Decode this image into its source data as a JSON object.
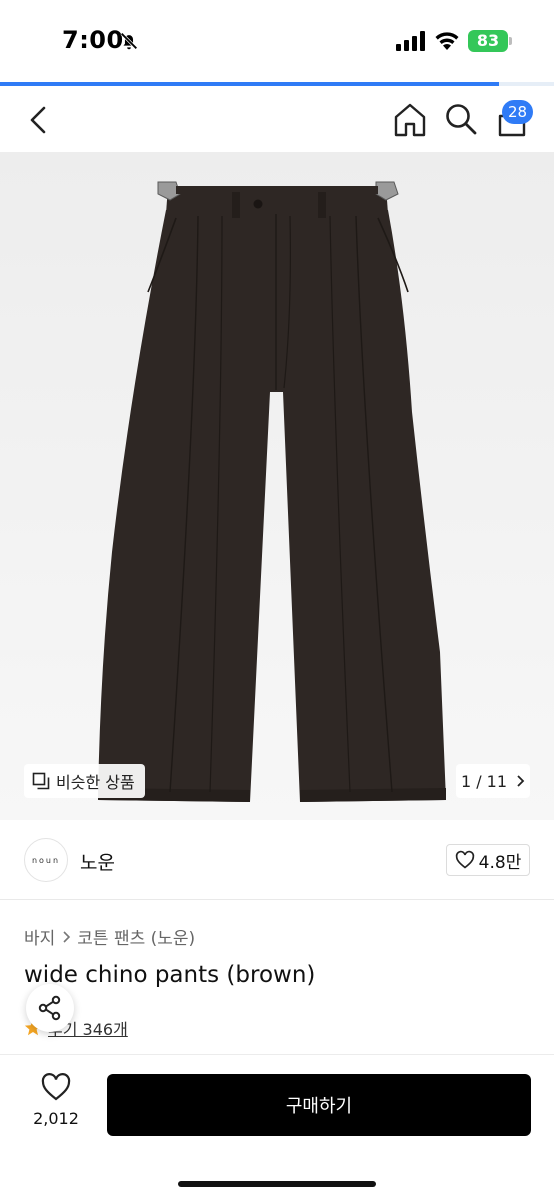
{
  "status_bar": {
    "time": "7:00",
    "battery": "83"
  },
  "load_progress": 0.9,
  "header": {
    "cart_count": "28"
  },
  "gallery": {
    "similar_label": "비슷한 상품",
    "page_indicator": "1 / 11"
  },
  "brand": {
    "logo_text": "noun",
    "name": "노운",
    "likes": "4.8만"
  },
  "breadcrumb": {
    "category": "바지",
    "subcategory": "코튼 팬츠 (노운)"
  },
  "product": {
    "title": "wide chino pants (brown)",
    "review_link": "후기 346개",
    "pants_color": "#2e2724"
  },
  "bottom_bar": {
    "wish_count": "2,012",
    "buy_label": "구매하기"
  },
  "colors": {
    "accent": "#2f7bf6",
    "battery": "#34c759",
    "buy_button": "#000000"
  }
}
